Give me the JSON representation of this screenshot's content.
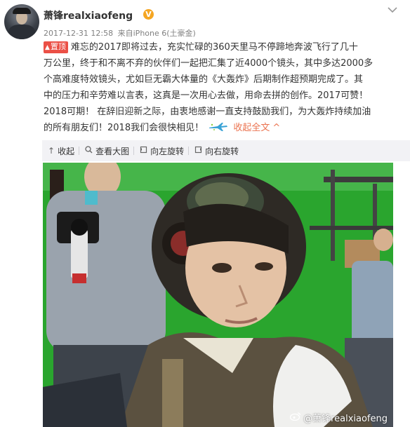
{
  "post": {
    "username": "萧锋realxiaofeng",
    "verified_badge": "V",
    "timestamp": "2017-12-31 12:58",
    "via_prefix": "来自",
    "device": "iPhone 6(土豪金)",
    "pin_label": "置顶",
    "body_lines": [
      "难忘的2017即将过去，充实忙碌的360天里马不停蹄地奔波飞行了几十",
      "万公里，终于和不离不弃的伙伴们一起把汇集了近4000个镜头，其中多达2000多",
      "个高难度特效镜头，尤如巨无霸大体量的《大轰炸》后期制作超预期完成了。其",
      "中的压力和辛劳难以言表，这真是一次用心去做，用命去拼的创作。2017可赞！",
      "2018可期！ 在辞旧迎新之际，由衷地感谢一直支持鼓励我们，为大轰炸持续加油",
      "的所有朋友们！2018我们会很快相见！"
    ],
    "collapse_label": "收起全文",
    "icons": {
      "avatar": "avatar",
      "verified": "verified-badge-icon",
      "menu": "chevron-down-icon",
      "pin": "arrow-up-icon",
      "plane": "airplane-icon",
      "collapse": "caret-up-icon"
    }
  },
  "toolbar": {
    "items": [
      {
        "icon": "arrow-up-icon",
        "label": "收起"
      },
      {
        "icon": "search-icon",
        "label": "查看大图"
      },
      {
        "icon": "rotate-left-icon",
        "label": "向左旋转"
      },
      {
        "icon": "rotate-right-icon",
        "label": "向右旋转"
      }
    ]
  },
  "photo": {
    "watermark": "@萧锋realxiaofeng",
    "watermark_icon": "weibo-icon"
  },
  "colors": {
    "accent": "#eb7350",
    "pin": "#eb5046",
    "badge": "#f5a623",
    "toolbar_bg": "#f2f2f5",
    "green_screen": "#24a32c"
  }
}
